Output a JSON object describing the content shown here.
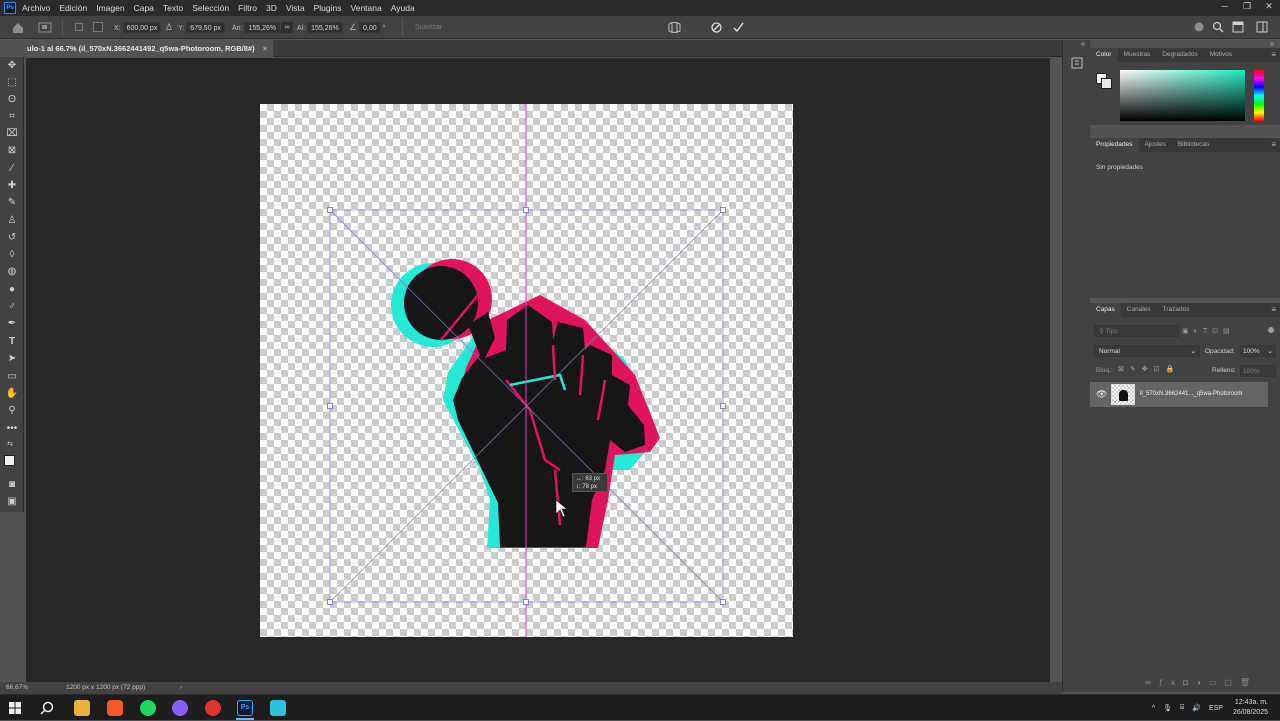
{
  "menubar": {
    "logo": "Ps",
    "items": [
      "Archivo",
      "Edición",
      "Imagen",
      "Capa",
      "Texto",
      "Selección",
      "Filtro",
      "3D",
      "Vista",
      "Plugins",
      "Ventana",
      "Ayuda"
    ]
  },
  "options": {
    "x_label": "X:",
    "x_value": "600,00 px",
    "y_label": "Y:",
    "y_value": "679,50 px",
    "w_label": "An:",
    "w_value": "155,26%",
    "h_label": "Al:",
    "h_value": "155,26%",
    "angle_value": "0,00",
    "degree": "°",
    "interp_label": "Suavizar"
  },
  "document": {
    "tab_title": "ulo-1 al 66.7% (il_570xN.3662441492_q5wa-Photoroom, RGB/8#)",
    "close": "×"
  },
  "transform_hint": {
    "w": "↔: 63 px",
    "h": "↕: 78 px"
  },
  "status": {
    "zoom": "66,67%",
    "doc_size": "1200 px x 1200 px (72 ppp)",
    "arrow": "›"
  },
  "color_panel": {
    "tabs": [
      "Color",
      "Muestras",
      "Degradados",
      "Motivos"
    ]
  },
  "properties_panel": {
    "tabs": [
      "Propiedades",
      "Ajustes",
      "Bibliotecas"
    ],
    "empty_text": "Sin propiedades"
  },
  "layers_panel": {
    "tabs": [
      "Capas",
      "Canales",
      "Trazados"
    ],
    "search_placeholder": "Tipo",
    "blend_mode": "Normal",
    "opacity_label": "Opacidad:",
    "opacity_value": "100%",
    "lock_label": "Bloq.:",
    "fill_label": "Relleno:",
    "fill_value": "100%",
    "layers": [
      {
        "name": "il_570xN.3662441..._q5wa-Photoroom"
      }
    ]
  },
  "taskbar": {
    "language": "ESP",
    "time": "12:43a. m.",
    "date": "26/08/2025"
  },
  "colors": {
    "accent_cyan": "#25e8d5",
    "accent_magenta": "#e0145c",
    "guide_magenta": "#e040c0",
    "transform_box": "#7a7ae0"
  }
}
